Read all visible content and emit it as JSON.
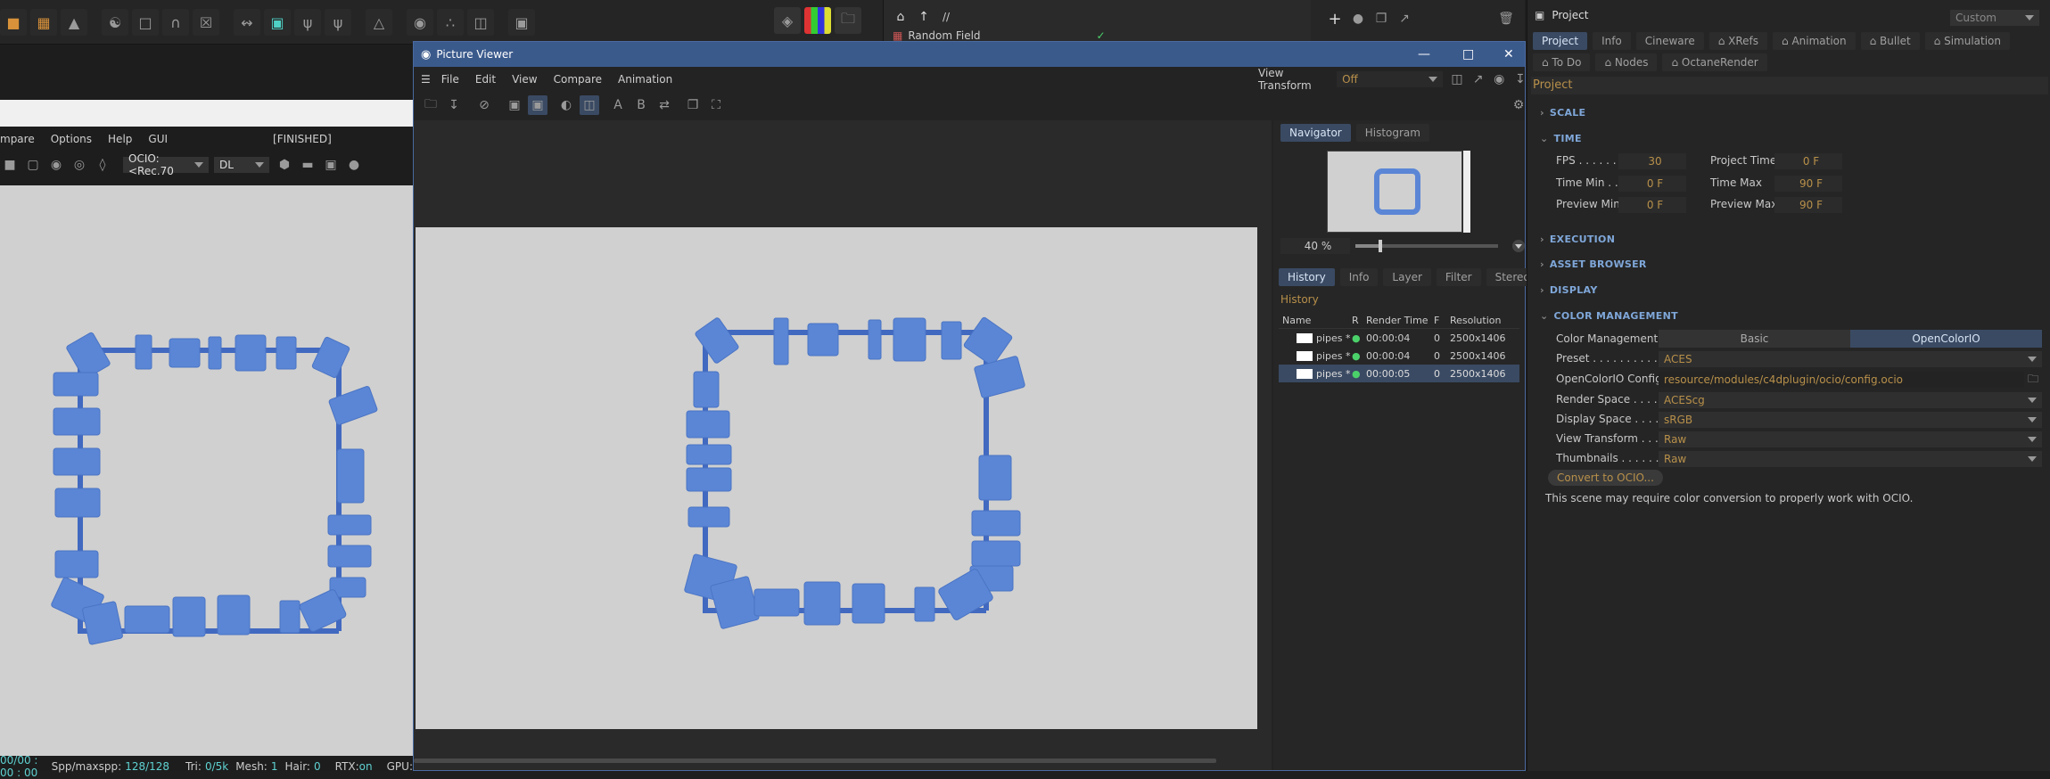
{
  "top_panel": {
    "path": "//",
    "random_field": "Random Field"
  },
  "attributes": {
    "title": "Project",
    "mode": "Custom",
    "tabs_row1": [
      "Project",
      "Info",
      "Cineware",
      "⌂ XRefs",
      "⌂ Animation",
      "⌂ Bullet",
      "⌂ Simulation"
    ],
    "tabs_row2": [
      "⌂ To Do",
      "⌂ Nodes",
      "⌂ OctaneRender"
    ],
    "section_header": "Project",
    "sections": {
      "scale": "SCALE",
      "time": "TIME",
      "execution": "EXECUTION",
      "asset_browser": "ASSET BROWSER",
      "display": "DISPLAY",
      "color_management": "COLOR MANAGEMENT"
    },
    "time": {
      "fps_label": "FPS . . . . . . . .",
      "fps": "30",
      "project_time_label": "Project Time",
      "project_time": "0 F",
      "time_min_label": "Time Min . . . .",
      "time_min": "0 F",
      "time_max_label": "Time Max",
      "time_max": "90 F",
      "preview_min_label": "Preview Min",
      "preview_min": "0 F",
      "preview_max_label": "Preview Max",
      "preview_max": "90 F"
    },
    "color": {
      "cm_label": "Color Management",
      "cm_basic": "Basic",
      "cm_ocio": "OpenColorIO",
      "preset_label": "Preset . . . . . . . . . . .",
      "preset": "ACES",
      "config_label": "OpenColorIO Config",
      "config": "resource/modules/c4dplugin/ocio/config.ocio",
      "render_label": "Render Space . . . . .",
      "render": "ACEScg",
      "display_label": "Display Space . . . . .",
      "display": "sRGB",
      "view_label": "View Transform . . .",
      "view": "Raw",
      "thumb_label": "Thumbnails . . . . . . . .",
      "thumb": "Raw",
      "convert_btn": "Convert to OCIO...",
      "note": "This scene may require color conversion to properly work with OCIO."
    }
  },
  "left_render": {
    "menu": [
      "mpare",
      "Options",
      "Help",
      "GUI"
    ],
    "status": "[FINISHED]",
    "ocio": "OCIO:<Rec.70",
    "dl": "DL",
    "stats": {
      "time": "00/00 : 00 : 00",
      "spp_label": "Spp/maxspp:",
      "spp": "128/128",
      "tri_label": "Tri:",
      "tri": "0/5k",
      "mesh_label": "Mesh:",
      "mesh": "1",
      "hair_label": "Hair:",
      "hair": "0",
      "rtx_label": "RTX:",
      "rtx": "on",
      "gpu_label": "GPU:"
    }
  },
  "picture_viewer": {
    "title": "Picture Viewer",
    "menu": [
      "File",
      "Edit",
      "View",
      "Compare",
      "Animation"
    ],
    "view_transform_label": "View Transform",
    "view_transform_value": "Off",
    "nav_tabs": [
      "Navigator",
      "Histogram"
    ],
    "zoom": "40 %",
    "history_tabs": [
      "History",
      "Info",
      "Layer",
      "Filter",
      "Stereo"
    ],
    "history_title": "History",
    "columns": [
      "Name",
      "R",
      "Render Time",
      "F",
      "Resolution"
    ],
    "rows": [
      {
        "name": "pipes *",
        "time": "00:00:04",
        "frame": "0",
        "res": "2500x1406"
      },
      {
        "name": "pipes *",
        "time": "00:00:04",
        "frame": "0",
        "res": "2500x1406"
      },
      {
        "name": "pipes *",
        "time": "00:00:05",
        "frame": "0",
        "res": "2500x1406"
      }
    ],
    "text_buttons": [
      "A",
      "B"
    ]
  },
  "colors": {
    "accent_blue": "#3a4a63",
    "render_blue": "#5b86d6",
    "status_green": "#4bd16a",
    "value_orange": "#b8904a"
  }
}
